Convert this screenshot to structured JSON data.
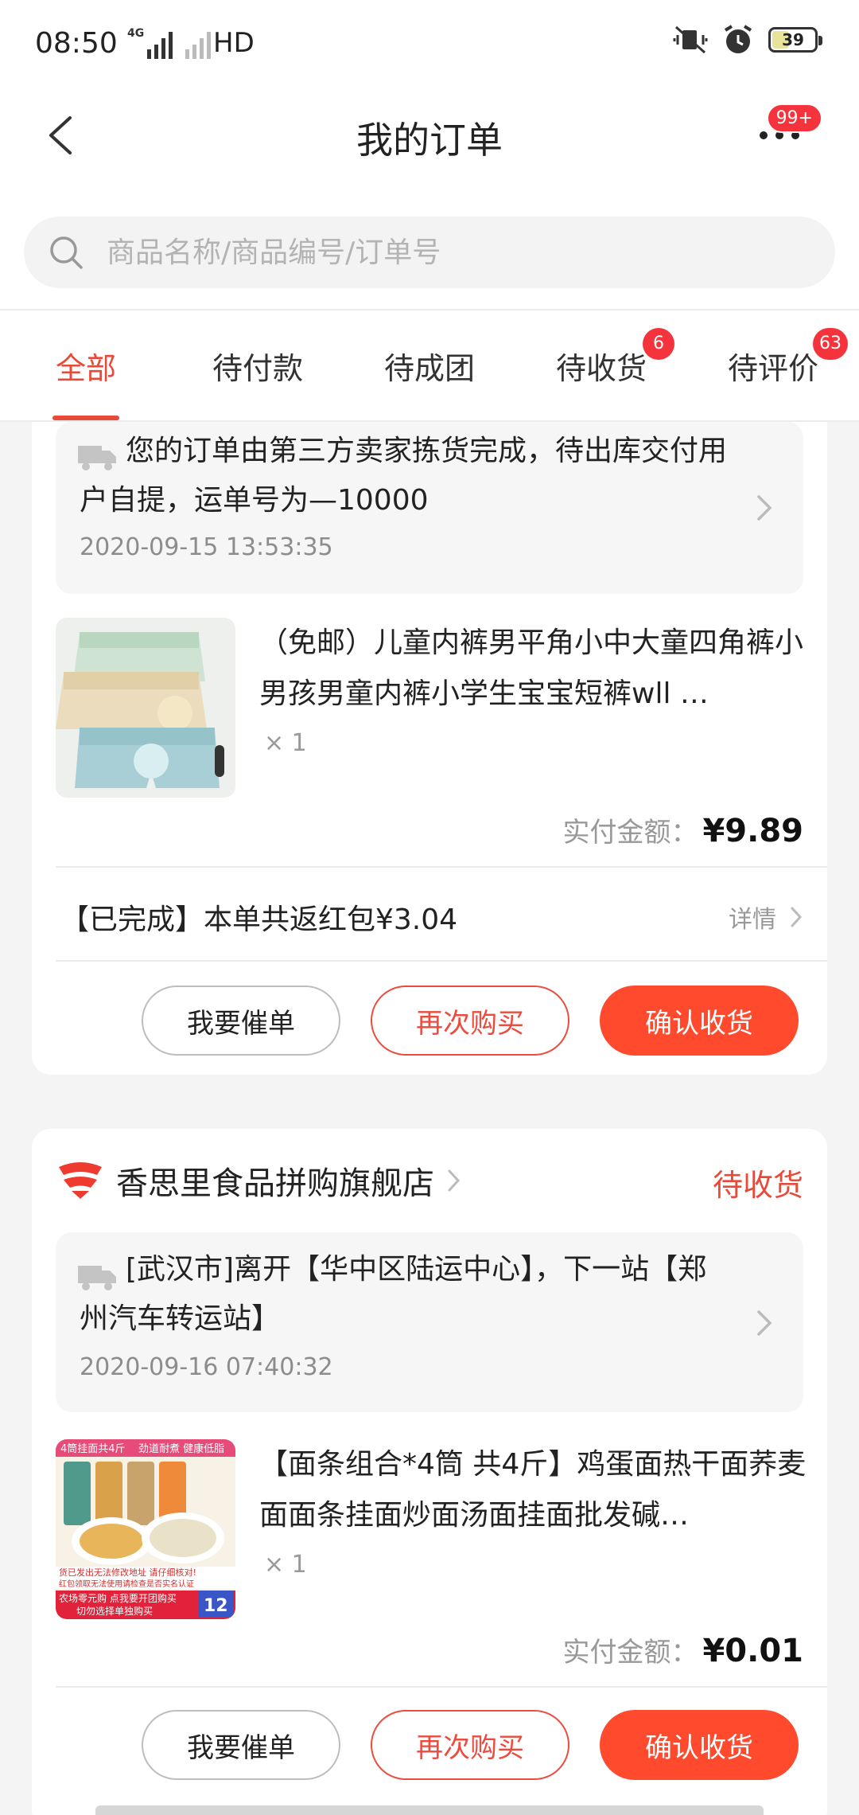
{
  "status_bar": {
    "time": "08:50",
    "net_tag": "4G",
    "hd": "HD",
    "battery": "39",
    "battery_level": 0.39
  },
  "nav": {
    "title": "我的订单",
    "more_badge": "99+"
  },
  "search": {
    "placeholder": "商品名称/商品编号/订单号"
  },
  "tabs": [
    {
      "label": "全部",
      "active": true,
      "badge": ""
    },
    {
      "label": "待付款",
      "badge": ""
    },
    {
      "label": "待成团",
      "badge": ""
    },
    {
      "label": "待收货",
      "badge": "6"
    },
    {
      "label": "待评价",
      "badge": "63"
    }
  ],
  "orders": [
    {
      "logistics_text": "您的订单由第三方卖家拣货完成，待出库交付用户自提，运单号为—10000",
      "logistics_time": "2020-09-15 13:53:35",
      "product_title": "（免邮）儿童内裤男平角小中大童四角裤小男孩男童内裤小学生宝宝短裤wll …",
      "qty": "× 1",
      "pay_label": "实付金额：",
      "pay_amount": "¥9.89",
      "redpack_text": "【已完成】本单共返红包¥3.04",
      "detail_label": "详情",
      "buttons": {
        "urge": "我要催单",
        "rebuy": "再次购买",
        "confirm": "确认收货"
      }
    },
    {
      "shop_name": "香思里食品拼购旗舰店",
      "status": "待收货",
      "logistics_text": "[武汉市]离开【华中区陆运中心】，下一站【郑州汽车转运站】",
      "logistics_time": "2020-09-16 07:40:32",
      "product_title": "【面条组合*4筒 共4斤】鸡蛋面热干面荞麦面面条挂面炒面汤面挂面批发碱…",
      "qty": "× 1",
      "pay_label": "实付金额：",
      "pay_amount": "¥0.01",
      "img_text": {
        "top_left": "4筒挂面共4斤",
        "top_right": "劲道耐煮 健康低脂",
        "note1": "货已发出无法修改地址 请仔细核对!",
        "note2": "红包领取无法使用请检查是否实名认证",
        "promo1": "农场零元购 点我要开团购买",
        "promo2": "切勿选择单独购买",
        "badge": "12"
      },
      "buttons": {
        "urge": "我要催单",
        "rebuy": "再次购买",
        "confirm": "确认收货"
      }
    }
  ],
  "colors": {
    "accent": "#e84a3a",
    "confirm_button": "#ff4a2e",
    "badge": "#f4333c"
  }
}
